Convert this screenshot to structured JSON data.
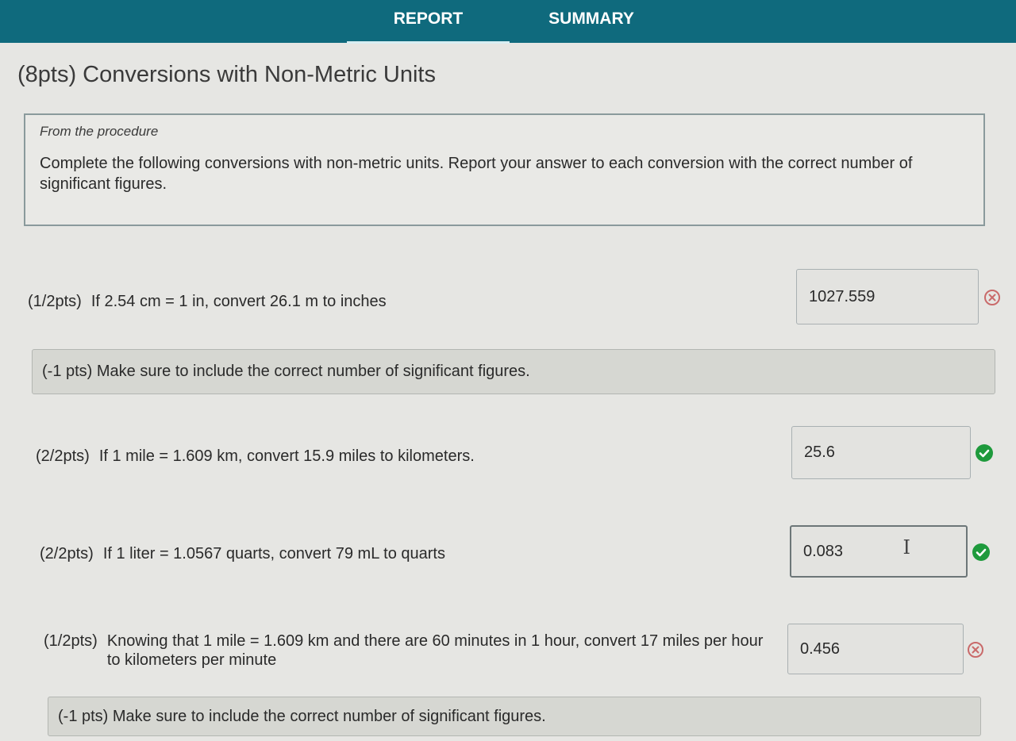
{
  "tabs": {
    "report": "REPORT",
    "summary": "SUMMARY",
    "active": "report"
  },
  "section": {
    "title": "(8pts) Conversions with Non-Metric Units",
    "procedure_caption": "From the procedure",
    "procedure_text": "Complete the following conversions with non-metric units. Report your answer to each conversion with the correct number of significant figures."
  },
  "questions": [
    {
      "points": "(1/2pts)",
      "text": "If 2.54 cm = 1 in, convert 26.1 m to inches",
      "answer": "1027.559",
      "status": "incorrect",
      "feedback": "(-1 pts) Make sure to include the correct number of significant figures."
    },
    {
      "points": "(2/2pts)",
      "text": "If 1 mile = 1.609 km, convert 15.9 miles to kilometers.",
      "answer": "25.6",
      "status": "correct"
    },
    {
      "points": "(2/2pts)",
      "text": "If 1 liter = 1.0567 quarts, convert 79 mL to quarts",
      "answer": "0.083",
      "status": "correct"
    },
    {
      "points": "(1/2pts)",
      "text": "Knowing that 1 mile = 1.609 km and there are 60 minutes in 1 hour, convert 17 miles per hour to kilometers per minute",
      "answer": "0.456",
      "status": "incorrect",
      "feedback": "(-1 pts) Make sure to include the correct number of significant figures."
    }
  ],
  "colors": {
    "topbar": "#0f6a7d",
    "correct": "#1e9a3c",
    "incorrect": "#c96a6a"
  }
}
